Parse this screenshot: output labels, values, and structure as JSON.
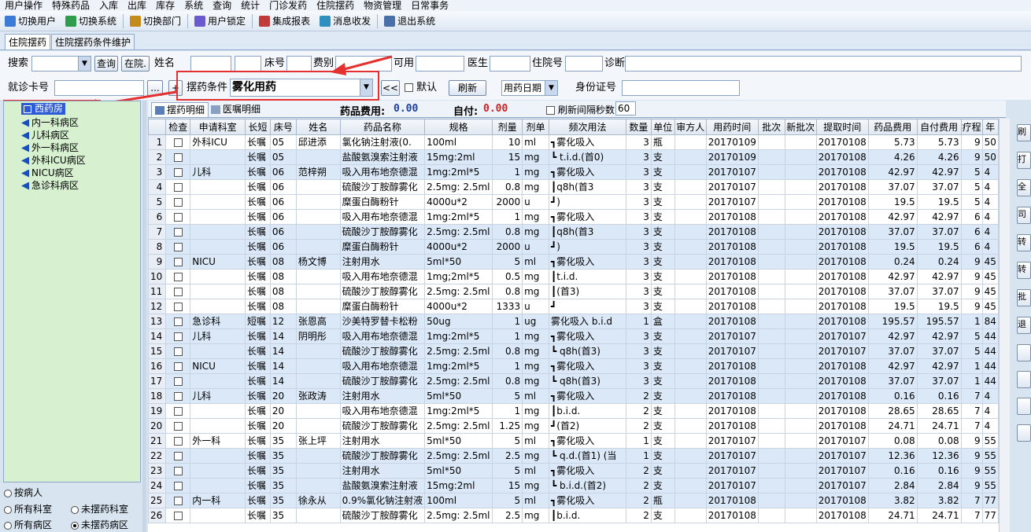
{
  "menu": [
    "用户操作",
    "特殊药品",
    "入库",
    "出库",
    "库存",
    "系统",
    "查询",
    "统计",
    "门诊发药",
    "住院摆药",
    "物资管理",
    "日常事务"
  ],
  "toolbar": [
    {
      "label": "切换用户",
      "icon": "user-switch-icon",
      "color": "#3a7bd5"
    },
    {
      "label": "切换系统",
      "icon": "system-switch-icon",
      "color": "#2e9e4a"
    },
    {
      "label": "切换部门",
      "icon": "department-switch-icon",
      "color": "#c48a1a"
    },
    {
      "label": "用户锁定",
      "icon": "lock-user-icon",
      "color": "#6a5acd"
    },
    {
      "label": "集成报表",
      "icon": "report-icon",
      "color": "#c23b3b"
    },
    {
      "label": "消息收发",
      "icon": "message-icon",
      "color": "#2f8fbf"
    },
    {
      "label": "退出系统",
      "icon": "exit-icon",
      "color": "#4b6fa8"
    }
  ],
  "tabs": [
    "住院摆药",
    "住院摆药条件维护"
  ],
  "form": {
    "search_label": "搜索",
    "query_btn": "查询",
    "inpatient_btn": "在院.",
    "name_label": "姓名",
    "bed_label": "床号",
    "fee_label": "费别",
    "available_label": "可用",
    "doctor_label": "医生",
    "inpatient_no_label": "住院号",
    "diagnosis_label": "诊断",
    "card_label": "就诊卡号",
    "more_btn": "...",
    "add_btn": "+",
    "condition_label": "摆药条件",
    "condition_value": "雾化用药",
    "prev_btn": "<<",
    "default_label": "默认",
    "refresh_btn": "刷新",
    "date_type": "用药日期",
    "id_label": "身份证号"
  },
  "tree": {
    "root": "西药房",
    "children": [
      "内一科病区",
      "儿科病区",
      "外一科病区",
      "外科ICU病区",
      "NICU病区",
      "急诊科病区"
    ]
  },
  "radios": [
    {
      "label": "按病人",
      "checked": false
    },
    {
      "label": "所有科室",
      "checked": false
    },
    {
      "label": "未摆药科室",
      "checked": false
    },
    {
      "label": "所有病区",
      "checked": false
    },
    {
      "label": "未摆药病区",
      "checked": true
    }
  ],
  "subtabs": [
    "摆药明细",
    "医嘱明细"
  ],
  "fee": {
    "drug_fee_label": "药品费用:",
    "drug_fee": "0.00",
    "self_pay_label": "自付:",
    "self_pay": "0.00",
    "refresh_interval_label": "刷新间隔秒数",
    "refresh_interval": "60"
  },
  "columns": [
    "检查",
    "申请科室",
    "长短",
    "床号",
    "姓名",
    "药品名称",
    "规格",
    "剂量",
    "剂单",
    "频次用法",
    "数量",
    "单位",
    "审方人",
    "用药时间",
    "批次",
    "新批次",
    "提取时间",
    "药品费用",
    "自付费用",
    "疗程",
    "年"
  ],
  "rows": [
    [
      "1",
      "外科ICU",
      "长嘱",
      "05",
      "邱进添",
      "氯化钠注射液(0.",
      "100ml",
      "10",
      "ml",
      "┓雾化吸入",
      "3",
      "瓶",
      "",
      "20170109",
      "",
      "",
      "20170108",
      "5.73",
      "5.73",
      "9",
      "50"
    ],
    [
      "2",
      "",
      "长嘱",
      "05",
      "",
      "盐酸氨溴索注射液",
      "15mg:2ml",
      "15",
      "mg",
      "┗ t.i.d.(首0)",
      "3",
      "支",
      "",
      "20170109",
      "",
      "",
      "20170108",
      "4.26",
      "4.26",
      "9",
      "50"
    ],
    [
      "3",
      "儿科",
      "长嘱",
      "06",
      "范梓朔",
      "吸入用布地奈德混",
      "1mg:2ml*5",
      "1",
      "mg",
      "┓雾化吸入",
      "3",
      "支",
      "",
      "20170107",
      "",
      "",
      "20170108",
      "42.97",
      "42.97",
      "5",
      "4"
    ],
    [
      "4",
      "",
      "长嘱",
      "06",
      "",
      "硫酸沙丁胺醇雾化",
      "2.5mg: 2.5ml",
      "0.8",
      "mg",
      "┃q8h(首3",
      "3",
      "支",
      "",
      "20170107",
      "",
      "",
      "20170108",
      "37.07",
      "37.07",
      "5",
      "4"
    ],
    [
      "5",
      "",
      "长嘱",
      "06",
      "",
      "糜蛋白酶粉针",
      "4000u*2",
      "2000",
      "u",
      "┛)",
      "3",
      "支",
      "",
      "20170107",
      "",
      "",
      "20170108",
      "19.5",
      "19.5",
      "5",
      "4"
    ],
    [
      "6",
      "",
      "长嘱",
      "06",
      "",
      "吸入用布地奈德混",
      "1mg:2ml*5",
      "1",
      "mg",
      "┓雾化吸入",
      "3",
      "支",
      "",
      "20170108",
      "",
      "",
      "20170108",
      "42.97",
      "42.97",
      "6",
      "4"
    ],
    [
      "7",
      "",
      "长嘱",
      "06",
      "",
      "硫酸沙丁胺醇雾化",
      "2.5mg: 2.5ml",
      "0.8",
      "mg",
      "┃q8h(首3",
      "3",
      "支",
      "",
      "20170108",
      "",
      "",
      "20170108",
      "37.07",
      "37.07",
      "6",
      "4"
    ],
    [
      "8",
      "",
      "长嘱",
      "06",
      "",
      "糜蛋白酶粉针",
      "4000u*2",
      "2000",
      "u",
      "┛)",
      "3",
      "支",
      "",
      "20170108",
      "",
      "",
      "20170108",
      "19.5",
      "19.5",
      "6",
      "4"
    ],
    [
      "9",
      "NICU",
      "长嘱",
      "08",
      "杨文博",
      "注射用水",
      "5ml*50",
      "5",
      "ml",
      "┓雾化吸入",
      "3",
      "支",
      "",
      "20170108",
      "",
      "",
      "20170108",
      "0.24",
      "0.24",
      "9",
      "45"
    ],
    [
      "10",
      "",
      "长嘱",
      "08",
      "",
      "吸入用布地奈德混",
      "1mg;2ml*5",
      "0.5",
      "mg",
      "┃t.i.d.",
      "3",
      "支",
      "",
      "20170108",
      "",
      "",
      "20170108",
      "42.97",
      "42.97",
      "9",
      "45"
    ],
    [
      "11",
      "",
      "长嘱",
      "08",
      "",
      "硫酸沙丁胺醇雾化",
      "2.5mg: 2.5ml",
      "0.8",
      "mg",
      "┃(首3)",
      "3",
      "支",
      "",
      "20170108",
      "",
      "",
      "20170108",
      "37.07",
      "37.07",
      "9",
      "45"
    ],
    [
      "12",
      "",
      "长嘱",
      "08",
      "",
      "糜蛋白酶粉针",
      "4000u*2",
      "1333",
      "u",
      "┛",
      "3",
      "支",
      "",
      "20170108",
      "",
      "",
      "20170108",
      "19.5",
      "19.5",
      "9",
      "45"
    ],
    [
      "13",
      "急诊科",
      "短嘱",
      "12",
      "张恩高",
      "沙美特罗替卡松粉",
      "50ug",
      "1",
      "ug",
      "雾化吸入 b.i.d",
      "1",
      "盒",
      "",
      "20170108",
      "",
      "",
      "20170108",
      "195.57",
      "195.57",
      "1",
      "84"
    ],
    [
      "14",
      "儿科",
      "长嘱",
      "14",
      "阴明彤",
      "吸入用布地奈德混",
      "1mg:2ml*5",
      "1",
      "mg",
      "┓雾化吸入",
      "3",
      "支",
      "",
      "20170107",
      "",
      "",
      "20170107",
      "42.97",
      "42.97",
      "5",
      "44"
    ],
    [
      "15",
      "",
      "长嘱",
      "14",
      "",
      "硫酸沙丁胺醇雾化",
      "2.5mg: 2.5ml",
      "0.8",
      "mg",
      "┗ q8h(首3)",
      "3",
      "支",
      "",
      "20170107",
      "",
      "",
      "20170107",
      "37.07",
      "37.07",
      "5",
      "44"
    ],
    [
      "16",
      "NICU",
      "长嘱",
      "14",
      "",
      "吸入用布地奈德混",
      "1mg:2ml*5",
      "1",
      "mg",
      "┓雾化吸入",
      "3",
      "支",
      "",
      "20170108",
      "",
      "",
      "20170108",
      "42.97",
      "42.97",
      "1",
      "44"
    ],
    [
      "17",
      "",
      "长嘱",
      "14",
      "",
      "硫酸沙丁胺醇雾化",
      "2.5mg: 2.5ml",
      "0.8",
      "mg",
      "┗ q8h(首3)",
      "3",
      "支",
      "",
      "20170108",
      "",
      "",
      "20170108",
      "37.07",
      "37.07",
      "1",
      "44"
    ],
    [
      "18",
      "儿科",
      "长嘱",
      "20",
      "张政涛",
      "注射用水",
      "5ml*50",
      "5",
      "ml",
      "┓雾化吸入",
      "2",
      "支",
      "",
      "20170108",
      "",
      "",
      "20170108",
      "0.16",
      "0.16",
      "7",
      "4"
    ],
    [
      "19",
      "",
      "长嘱",
      "20",
      "",
      "吸入用布地奈德混",
      "1mg:2ml*5",
      "1",
      "mg",
      "┃b.i.d.",
      "2",
      "支",
      "",
      "20170108",
      "",
      "",
      "20170108",
      "28.65",
      "28.65",
      "7",
      "4"
    ],
    [
      "20",
      "",
      "长嘱",
      "20",
      "",
      "硫酸沙丁胺醇雾化",
      "2.5mg: 2.5ml",
      "1.25",
      "mg",
      "┛(首2)",
      "2",
      "支",
      "",
      "20170108",
      "",
      "",
      "20170108",
      "24.71",
      "24.71",
      "7",
      "4"
    ],
    [
      "21",
      "外一科",
      "长嘱",
      "35",
      "张上坪",
      "注射用水",
      "5ml*50",
      "5",
      "ml",
      "┓雾化吸入",
      "1",
      "支",
      "",
      "20170107",
      "",
      "",
      "20170107",
      "0.08",
      "0.08",
      "9",
      "55"
    ],
    [
      "22",
      "",
      "长嘱",
      "35",
      "",
      "硫酸沙丁胺醇雾化",
      "2.5mg: 2.5ml",
      "2.5",
      "mg",
      "┗ q.d.(首1) (当",
      "1",
      "支",
      "",
      "20170107",
      "",
      "",
      "20170107",
      "12.36",
      "12.36",
      "9",
      "55"
    ],
    [
      "23",
      "",
      "长嘱",
      "35",
      "",
      "注射用水",
      "5ml*50",
      "5",
      "ml",
      "┓雾化吸入",
      "2",
      "支",
      "",
      "20170107",
      "",
      "",
      "20170107",
      "0.16",
      "0.16",
      "9",
      "55"
    ],
    [
      "24",
      "",
      "长嘱",
      "35",
      "",
      "盐酸氨溴索注射液",
      "15mg:2ml",
      "15",
      "mg",
      "┗ b.i.d.(首2)",
      "2",
      "支",
      "",
      "20170107",
      "",
      "",
      "20170107",
      "2.84",
      "2.84",
      "9",
      "55"
    ],
    [
      "25",
      "内一科",
      "长嘱",
      "35",
      "徐永从",
      "0.9%氯化钠注射液",
      "100ml",
      "5",
      "ml",
      "┓雾化吸入",
      "2",
      "瓶",
      "",
      "20170108",
      "",
      "",
      "20170108",
      "3.82",
      "3.82",
      "7",
      "77"
    ],
    [
      "26",
      "",
      "长嘱",
      "35",
      "",
      "硫酸沙丁胺醇雾化",
      "2.5mg: 2.5ml",
      "2.5",
      "mg",
      "┃b.i.d.",
      "2",
      "支",
      "",
      "20170108",
      "",
      "",
      "20170108",
      "24.71",
      "24.71",
      "7",
      "77"
    ]
  ],
  "right_buttons": [
    "刷",
    "打",
    "全",
    "司",
    "转",
    "转",
    "批",
    "退",
    "",
    "",
    "",
    ""
  ],
  "colors": {
    "accent": "#e53030",
    "tree_bg": "#d6f0d0",
    "fee_blue": "#1a3fa8",
    "fee_red": "#d42020"
  }
}
